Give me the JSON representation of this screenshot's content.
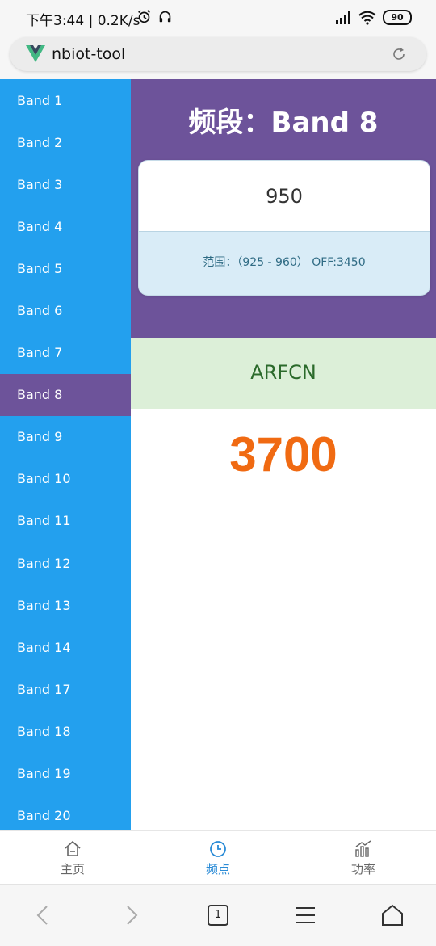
{
  "status_bar": {
    "time": "下午3:44 | 0.2K/s",
    "battery": "90"
  },
  "browser": {
    "url": "nbiot-tool",
    "tabs_count": "1"
  },
  "sidebar": {
    "items": [
      {
        "label": "Band 1"
      },
      {
        "label": "Band 2"
      },
      {
        "label": "Band 3"
      },
      {
        "label": "Band 4"
      },
      {
        "label": "Band 5"
      },
      {
        "label": "Band 6"
      },
      {
        "label": "Band 7"
      },
      {
        "label": "Band 8"
      },
      {
        "label": "Band 9"
      },
      {
        "label": "Band 10"
      },
      {
        "label": "Band 11"
      },
      {
        "label": "Band 12"
      },
      {
        "label": "Band 13"
      },
      {
        "label": "Band 14"
      },
      {
        "label": "Band 17"
      },
      {
        "label": "Band 18"
      },
      {
        "label": "Band 19"
      },
      {
        "label": "Band 20"
      }
    ],
    "active_label": "Band 8"
  },
  "main": {
    "title": "频段：Band 8",
    "frequency_value": "950",
    "range_text": "范围：（925 - 960） OFF:3450",
    "arfcn_label": "ARFCN",
    "arfcn_value": "3700"
  },
  "tabbar": {
    "tabs": [
      {
        "label": "主页",
        "icon": "home-icon"
      },
      {
        "label": "频点",
        "icon": "clock-icon"
      },
      {
        "label": "功率",
        "icon": "bar-chart-icon"
      }
    ],
    "active_index": 1
  },
  "colors": {
    "sidebar_bg": "#23a0ee",
    "accent_purple": "#6d539a",
    "arfcn_bg": "#dcefd8",
    "arfcn_value": "#f06a12",
    "tab_active": "#2a8bd6"
  }
}
